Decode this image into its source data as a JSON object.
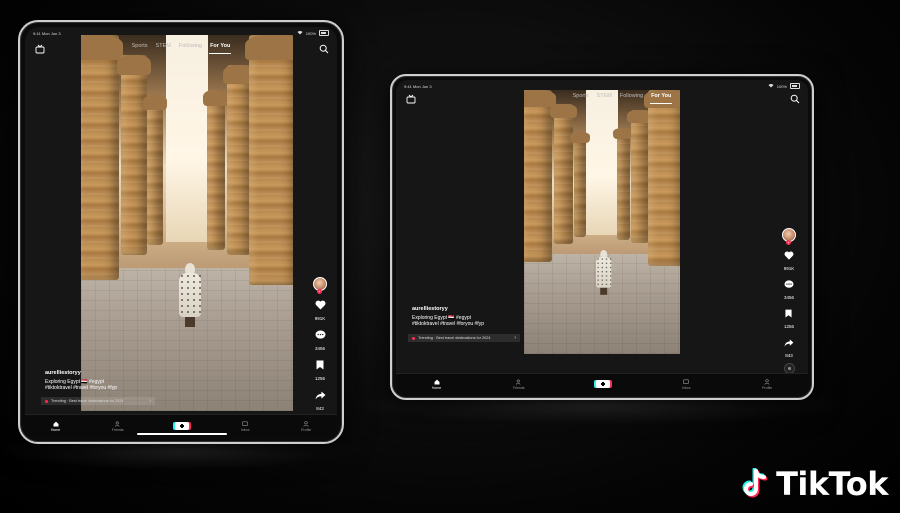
{
  "brand": {
    "name": "TikTok",
    "colors": {
      "cyan": "#25f4ee",
      "red": "#fe2c55",
      "white": "#ffffff"
    }
  },
  "status": {
    "time": "9:41",
    "date": "Mon Jun 3",
    "battery": "100%"
  },
  "top_nav": {
    "tabs": [
      {
        "label": "Sports",
        "active": false
      },
      {
        "label": "STEM",
        "active": false
      },
      {
        "label": "Following",
        "active": false
      },
      {
        "label": "For You",
        "active": true
      }
    ]
  },
  "post": {
    "username": "aurelliestoryy",
    "caption": "Exploring Egypt 🇪🇬 #egypt",
    "hashtags": "#tiktoktravel #travel #foryou #fyp",
    "trending": "Trending · Best travel destinations for 2024"
  },
  "actions": {
    "likes": "991K",
    "comments": "3456",
    "saves": "1256",
    "shares": "843"
  },
  "bottom_nav": {
    "items": [
      {
        "label": "Home",
        "icon": "home-icon",
        "active": true
      },
      {
        "label": "Friends",
        "icon": "friends-icon",
        "active": false
      },
      {
        "label": "",
        "icon": "create-icon",
        "active": false
      },
      {
        "label": "Inbox",
        "icon": "inbox-icon",
        "active": false
      },
      {
        "label": "Profile",
        "icon": "profile-icon",
        "active": false
      }
    ]
  }
}
